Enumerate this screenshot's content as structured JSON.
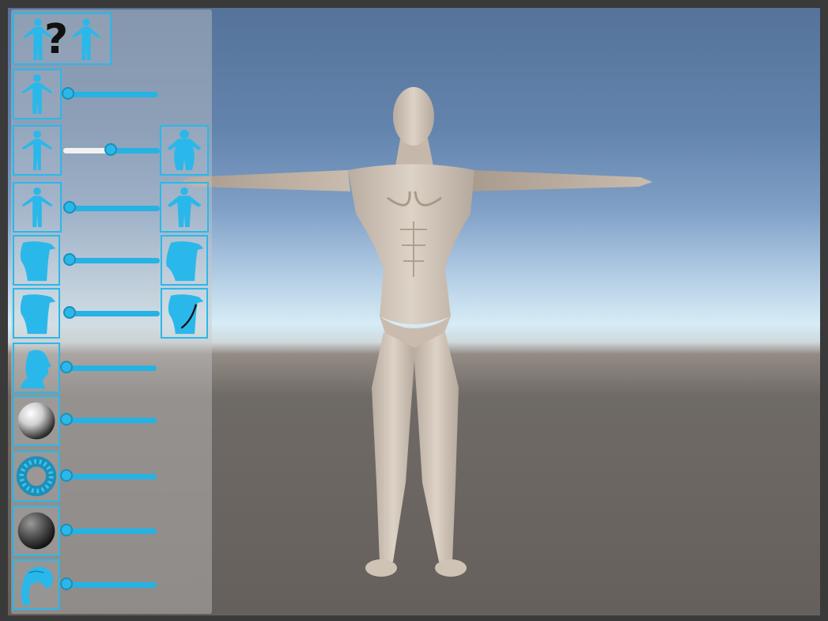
{
  "ui": {
    "accent": "#2ab8ea",
    "help_text": "?",
    "sliders": [
      {
        "id": "body-size",
        "value": 0.0,
        "left_icon": "body-icon",
        "right_icon": ""
      },
      {
        "id": "body-weight",
        "value": 0.5,
        "left_icon": "thin-body-icon",
        "right_icon": "heavy-body-icon"
      },
      {
        "id": "body-muscle",
        "value": 0.0,
        "left_icon": "body-icon",
        "right_icon": "muscular-body-icon"
      },
      {
        "id": "breast-size",
        "value": 0.0,
        "left_icon": "torso-icon",
        "right_icon": "large-breast-torso-icon"
      },
      {
        "id": "breast-shape",
        "value": 0.0,
        "left_icon": "torso-icon",
        "right_icon": "torso-outline-icon"
      },
      {
        "id": "head-shape",
        "value": 0.0,
        "left_icon": "head-icon",
        "right_icon": ""
      },
      {
        "id": "skin-gloss",
        "value": 0.0,
        "left_icon": "glossy-sphere-icon",
        "right_icon": ""
      },
      {
        "id": "skin-detail",
        "value": 0.0,
        "left_icon": "torus-texture-icon",
        "right_icon": ""
      },
      {
        "id": "skin-tone",
        "value": 0.0,
        "left_icon": "dark-sphere-icon",
        "right_icon": ""
      },
      {
        "id": "hair",
        "value": 0.0,
        "left_icon": "hair-icon",
        "right_icon": ""
      }
    ]
  }
}
